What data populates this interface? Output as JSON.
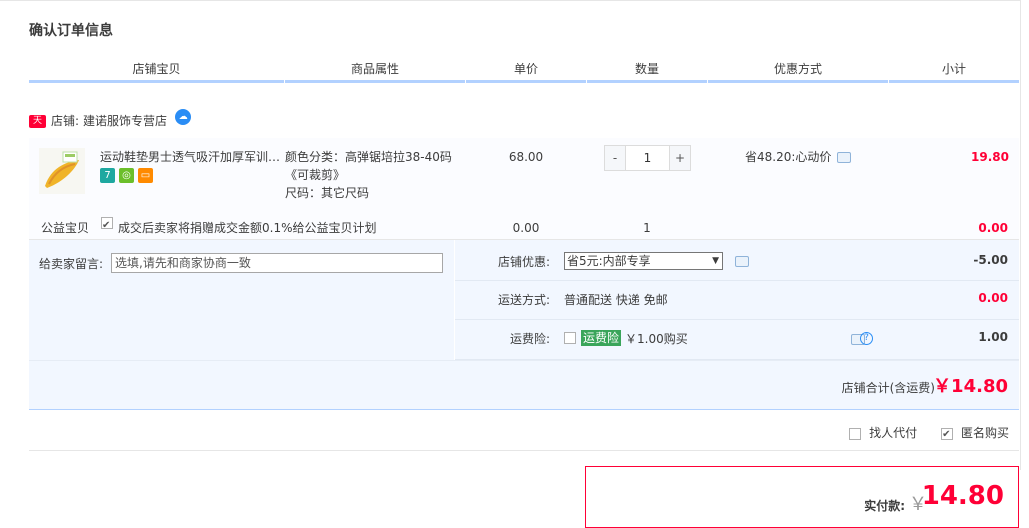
{
  "title": "确认订单信息",
  "headers": [
    "店铺宝贝",
    "商品属性",
    "单价",
    "数量",
    "优惠方式",
    "小计"
  ],
  "shop": {
    "badge": "天猫",
    "label": "店铺:",
    "name": "建诺服饰专营店",
    "wangwang_icon": "wangwang-chat-icon"
  },
  "item": {
    "name": "运动鞋垫男士透气吸汗加厚军训…",
    "badges": [
      {
        "text": "7",
        "color": "#1ea8a0"
      },
      {
        "text": "◎",
        "color": "#6cbf2a"
      },
      {
        "text": "▭",
        "color": "#ff8a00"
      }
    ],
    "attr_color": "颜色分类：高弹锯培拉38-40码《可裁剪》",
    "attr_size": "尺码：其它尺码",
    "price": "68.00",
    "qty": "1",
    "minus": "-",
    "plus": "+",
    "promo": "省48.20:心动价",
    "subtotal": "19.80"
  },
  "charity": {
    "label": "公益宝贝",
    "text": "成交后卖家将捐赠成交金额0.1%给公益宝贝计划",
    "price": "0.00",
    "qty": "1",
    "subtotal": "0.00",
    "checked": true
  },
  "memo": {
    "label": "给卖家留言:",
    "placeholder": "选填,请先和商家协商一致"
  },
  "discount": {
    "label": "店铺优惠:",
    "selected": "省5元:内部专享",
    "value": "-5.00"
  },
  "shipping": {
    "label": "运送方式:",
    "value_text": "普通配送 快递 免邮",
    "value": "0.00"
  },
  "insurance": {
    "label": "运费险:",
    "tag": "运费险",
    "price_text": "￥1.00购买",
    "value": "1.00"
  },
  "shop_total": {
    "label": "店铺合计(含运费)",
    "value": "￥14.80"
  },
  "options": {
    "proxy_pay": "找人代付",
    "anonymous": "匿名购买"
  },
  "payment": {
    "label": "实付款:",
    "currency": "￥",
    "value": "14.80"
  },
  "colors": {
    "accent_red": "#ff0036",
    "header_line": "#b2d1ff",
    "panel_bg": "#f2f7ff"
  }
}
